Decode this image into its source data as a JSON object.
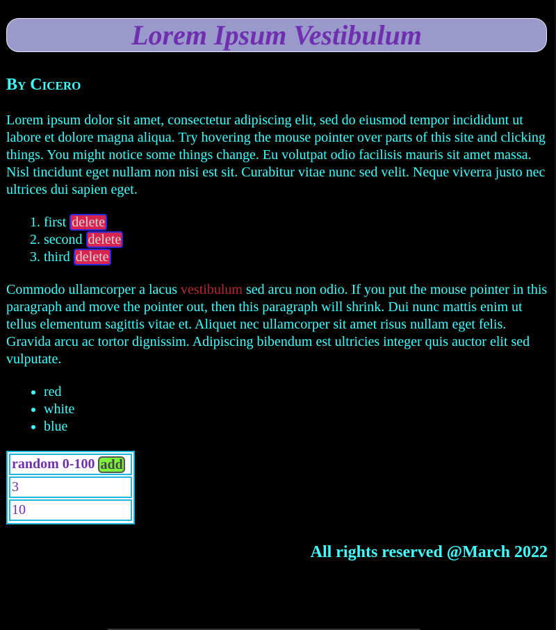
{
  "header": {
    "title": "Lorem Ipsum Vestibulum",
    "author": "By Cicero"
  },
  "intro": {
    "text": "Lorem ipsum dolor sit amet, consectetur adipiscing elit, sed do eiusmod tempor incididunt ut labore et dolore magna aliqua. Try hovering the mouse pointer over parts of this site and clicking things. You might notice some things change. Eu volutpat odio facilisis mauris sit amet massa. Nisl tincidunt eget nullam non nisi est sit. Curabitur vitae nunc sed velit. Neque viverra justo nec ultrices dui sapien eget."
  },
  "ordered_list": {
    "items": [
      {
        "label": "first",
        "button": "delete"
      },
      {
        "label": "second",
        "button": "delete"
      },
      {
        "label": "third",
        "button": "delete"
      }
    ]
  },
  "paragraph2": {
    "before": "Commodo ullamcorper a lacus ",
    "highlight": "vestibulum",
    "after": " sed arcu non odio. If you put the mouse pointer in this paragraph and move the pointer out, then this paragraph will shrink. Dui nunc mattis enim ut tellus elementum sagittis vitae et. Aliquet nec ullamcorper sit amet risus nullam eget felis. Gravida arcu ac tortor dignissim. Adipiscing bibendum est ultricies integer quis auctor elit sed vulputate."
  },
  "unordered_list": {
    "items": [
      "red",
      "white",
      "blue"
    ]
  },
  "random_widget": {
    "label": "random 0-100",
    "button": "add",
    "values": [
      "3",
      "10"
    ]
  },
  "footer": {
    "text": "All rights reserved @March 2022"
  },
  "colors": {
    "background": "#000000",
    "text": "#40ffff",
    "banner": "#9999cc",
    "title": "#6f2faf",
    "delete_button": "#d8244f",
    "add_button": "#7cf23c",
    "highlight": "#b5292e"
  }
}
